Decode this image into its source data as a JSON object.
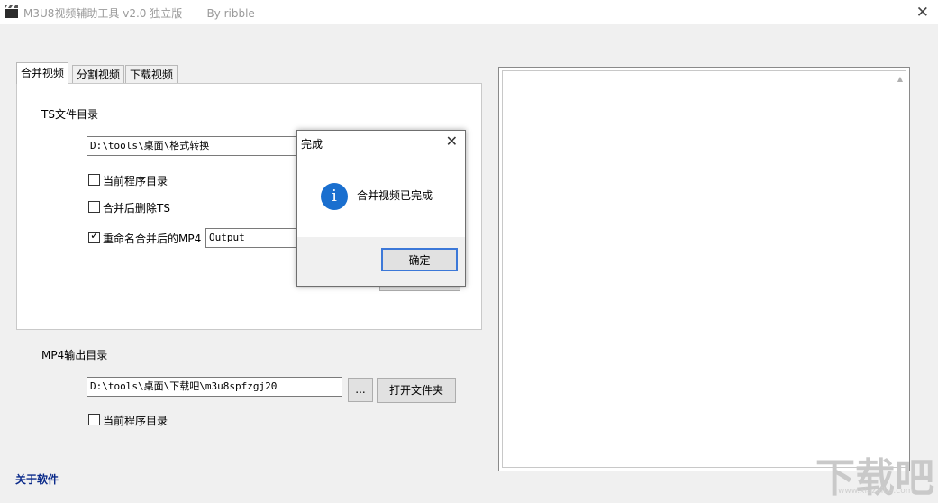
{
  "window": {
    "title": "M3U8视频辅助工具 v2.0 独立版     - By ribble",
    "close_glyph": "✕",
    "app_icon": "film-clapper-icon"
  },
  "tabs": [
    {
      "label": "合并视频",
      "active": true
    },
    {
      "label": "分割视频",
      "active": false
    },
    {
      "label": "下载视频",
      "active": false
    }
  ],
  "merge": {
    "ts_dir_label": "TS文件目录",
    "ts_dir_value": "D:\\tools\\桌面\\格式转换",
    "current_dir_label": "当前程序目录",
    "current_dir_checked": false,
    "delete_ts_label": "合并后删除TS",
    "delete_ts_checked": false,
    "rename_label": "重命名合并后的MP4",
    "rename_checked": true,
    "rename_value": "Output"
  },
  "output": {
    "label": "MP4输出目录",
    "value": "D:\\tools\\桌面\\下载吧\\m3u8spfzgj20",
    "browse_label": "...",
    "open_folder_label": "打开文件夹",
    "current_dir_label": "当前程序目录",
    "current_dir_checked": false
  },
  "about_label": "关于软件",
  "dialog": {
    "title": "完成",
    "close_glyph": "✕",
    "icon": "info-icon",
    "icon_glyph": "i",
    "message": "合并视频已完成",
    "ok_label": "确定",
    "accent": "#1a6fcf"
  },
  "watermark": {
    "text": "下载吧",
    "sub": "www.xiazaiba.com"
  },
  "log": {
    "scroll_glyph": "▲"
  },
  "check_glyph": "✓"
}
